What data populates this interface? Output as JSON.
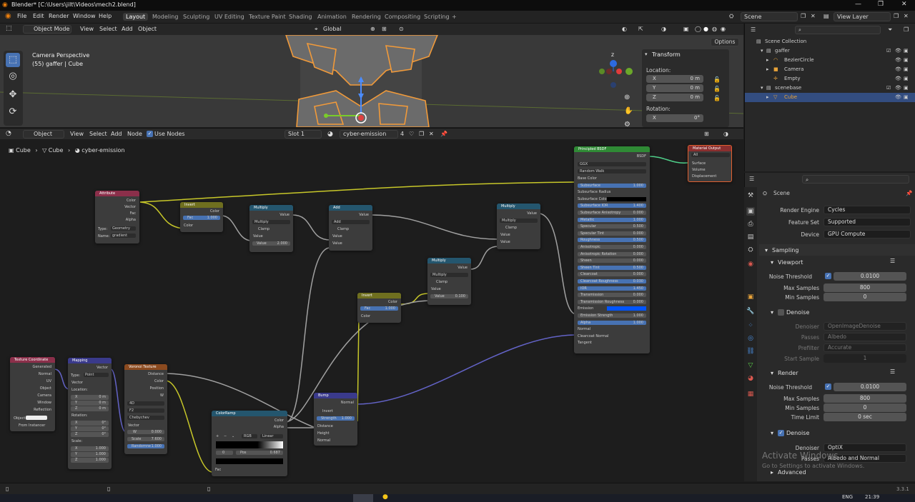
{
  "window": {
    "title": "Blender* [C:\\Users\\jilt\\Videos\\mech2.blend]",
    "min": "—",
    "max": "❐",
    "close": "✕"
  },
  "menu": [
    "File",
    "Edit",
    "Render",
    "Window",
    "Help"
  ],
  "workspaces": [
    "Layout",
    "Modeling",
    "Sculpting",
    "UV Editing",
    "Texture Paint",
    "Shading",
    "Animation",
    "Rendering",
    "Compositing",
    "Scripting",
    "+"
  ],
  "scene": "Scene",
  "viewlayer": "View Layer",
  "viewport": {
    "mode": "Object Mode",
    "menus": [
      "View",
      "Select",
      "Add",
      "Object"
    ],
    "orient": "Global",
    "options": "Options",
    "overlay1": "Camera Perspective",
    "overlay2": "(55) gaffer | Cube",
    "transform": {
      "title": "Transform",
      "location": "Location:",
      "rotation": "Rotation:",
      "axes": [
        "X",
        "Y",
        "Z"
      ],
      "loc": [
        "0 m",
        "0 m",
        "0 m"
      ],
      "rotx": "0°"
    }
  },
  "nodeeditor": {
    "type": "Object",
    "menus": [
      "View",
      "Select",
      "Add",
      "Node"
    ],
    "use_nodes": "Use Nodes",
    "slot": "Slot 1",
    "material": "cyber-emission",
    "users": "4",
    "breadcrumb": [
      "Cube",
      "Cube",
      "cyber-emission"
    ]
  },
  "nodes": {
    "attribute": {
      "title": "Attribute",
      "outs": [
        "Color",
        "Vector",
        "Fac",
        "Alpha"
      ],
      "type_l": "Type:",
      "type_v": "Geometry",
      "name_l": "Name:",
      "name_v": "gradient"
    },
    "invert1": {
      "title": "Invert",
      "out": "Color",
      "fac": "Fac",
      "facv": "1.000",
      "in": "Color"
    },
    "mult1": {
      "title": "Multiply",
      "out": "Value",
      "op": "Multiply",
      "clamp": "Clamp",
      "v1": "Value",
      "v2": "Value",
      "v2v": "2.000"
    },
    "add": {
      "title": "Add",
      "out": "Value",
      "op": "Add",
      "clamp": "Clamp",
      "v1": "Value",
      "v2": "Value"
    },
    "mult2": {
      "title": "Multiply",
      "out": "Value",
      "op": "Multiply",
      "clamp": "Clamp",
      "v1": "Value",
      "v2": "Value"
    },
    "mult3": {
      "title": "Multiply",
      "out": "Value",
      "op": "Multiply",
      "clamp": "Clamp",
      "v1": "Value",
      "v2": "Value",
      "v2v": "0.100"
    },
    "invert2": {
      "title": "Invert",
      "out": "Color",
      "fac": "Fac",
      "facv": "1.000",
      "in": "Color"
    },
    "bsdf": {
      "title": "Principled BSDF",
      "out": "BSDF",
      "dist": "GGX",
      "sss": "Random Walk",
      "rows": [
        [
          "Base Color",
          ""
        ],
        [
          "Subsurface",
          "1.000"
        ],
        [
          "Subsurface Radius",
          ""
        ],
        [
          "Subsurface Colo",
          ""
        ],
        [
          "Subsurface IOR",
          "1.400"
        ],
        [
          "Subsurface Anisotropy",
          "0.000"
        ],
        [
          "Metallic",
          "1.000"
        ],
        [
          "Specular",
          "0.500"
        ],
        [
          "Specular Tint",
          "0.000"
        ],
        [
          "Roughness",
          "0.500"
        ],
        [
          "Anisotropic",
          "0.000"
        ],
        [
          "Anisotropic Rotation",
          "0.000"
        ],
        [
          "Sheen",
          "0.000"
        ],
        [
          "Sheen Tint",
          "0.500"
        ],
        [
          "Clearcoat",
          "0.000"
        ],
        [
          "Clearcoat Roughness",
          "0.030"
        ],
        [
          "IOR",
          "1.450"
        ],
        [
          "Transmission",
          "0.000"
        ],
        [
          "Transmission Roughness",
          "0.000"
        ],
        [
          "Emission",
          ""
        ],
        [
          "Emission Strength",
          "1.000"
        ],
        [
          "Alpha",
          "1.000"
        ],
        [
          "Normal",
          ""
        ],
        [
          "Clearcoat Normal",
          ""
        ],
        [
          "Tangent",
          ""
        ]
      ]
    },
    "matout": {
      "title": "Material Output",
      "target": "All",
      "ins": [
        "Surface",
        "Volume",
        "Displacement"
      ]
    },
    "texcoord": {
      "title": "Texture Coordinate",
      "outs": [
        "Generated",
        "Normal",
        "UV",
        "Object",
        "Camera",
        "Window",
        "Reflection"
      ],
      "obj": "Object:",
      "inst": "From Instancer"
    },
    "mapping": {
      "title": "Mapping",
      "out": "Vector",
      "type_l": "Type:",
      "type_v": "Point",
      "vec": "Vector",
      "loc": "Location:",
      "rot": "Rotation:",
      "scale": "Scale:",
      "axes": [
        "X",
        "Y",
        "Z"
      ],
      "locv": [
        "0 m",
        "0 m",
        "0 m"
      ],
      "rotv": [
        "0°",
        "0°",
        "0°"
      ],
      "scalev": [
        "1.000",
        "1.000",
        "1.000"
      ]
    },
    "voronoi": {
      "title": "Voronoi Texture",
      "outs": [
        "Distance",
        "Color",
        "Position",
        "W"
      ],
      "dim": "4D",
      "feat": "F2",
      "metric": "Chebychev",
      "vec": "Vector",
      "w": "W",
      "wv": "0.000",
      "scale": "Scale",
      "scalev": "7.600",
      "rand": "Randomne",
      "randv": "1.000"
    },
    "ramp": {
      "title": "ColorRamp",
      "outs": [
        "Color",
        "Alpha"
      ],
      "mode": "RGB",
      "interp": "Linear",
      "stop": "0",
      "pos": "Pos",
      "posv": "0.687",
      "fac": "Fac"
    },
    "bump": {
      "title": "Bump",
      "out": "Normal",
      "invert": "Invert",
      "strength": "Strength",
      "strv": "1.000",
      "ins": [
        "Distance",
        "Height",
        "Normal"
      ]
    }
  },
  "outliner": {
    "root": "Scene Collection",
    "items": [
      "gaffer",
      "BezierCircle",
      "Camera",
      "Empty",
      "scenebase",
      "Cube"
    ]
  },
  "properties": {
    "scene": "Scene",
    "engine_l": "Render Engine",
    "engine": "Cycles",
    "fs_l": "Feature Set",
    "fs": "Supported",
    "dev_l": "Device",
    "dev": "GPU Compute",
    "sampling": "Sampling",
    "viewport": "Viewport",
    "nt_l": "Noise Threshold",
    "nt": "0.0100",
    "maxs_l": "Max Samples",
    "maxs": "800",
    "mins_l": "Min Samples",
    "mins": "0",
    "denoise": "Denoise",
    "denoiser_l": "Denoiser",
    "denoiser_vp": "OpenImageDenoise",
    "passes_l": "Passes",
    "passes_vp": "Albedo",
    "prefilter_l": "Prefilter",
    "prefilter": "Accurate",
    "start_l": "Start Sample",
    "start": "1",
    "render": "Render",
    "rnt": "0.0100",
    "rmax": "800",
    "rmin": "0",
    "tl_l": "Time Limit",
    "tl": "0 sec",
    "rdenoiser": "OptiX",
    "rpasses": "Albedo and Normal",
    "advanced": "Advanced"
  },
  "watermark": {
    "l1": "Activate Windows",
    "l2": "Go to Settings to activate Windows."
  },
  "status": {
    "version": "3.3.1",
    "lang": "ENG",
    "time": "21:39"
  }
}
